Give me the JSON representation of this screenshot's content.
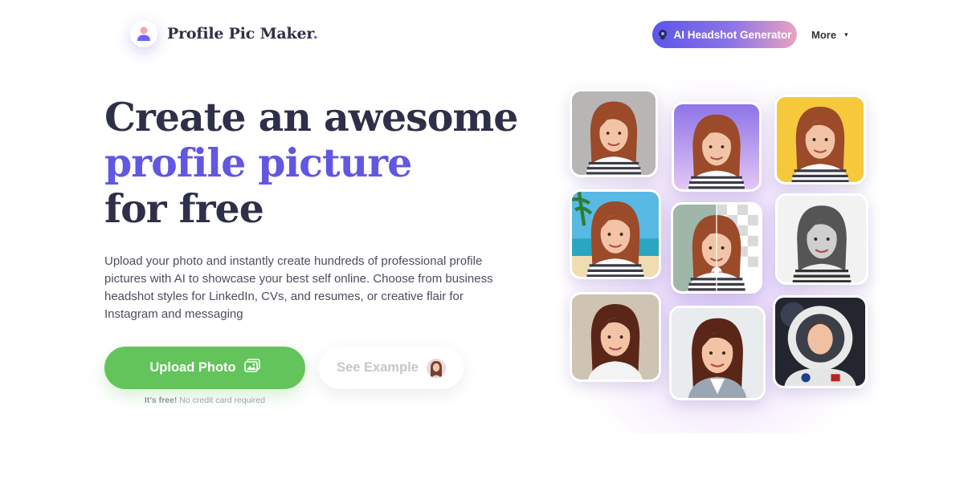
{
  "brand": {
    "name": "Profile Pic Maker",
    "dot": "."
  },
  "nav": {
    "ai_button_label": "AI Headshot Generator",
    "more_label": "More",
    "more_caret": "▾"
  },
  "hero": {
    "line1": "Create an awesome",
    "line2": "profile picture",
    "line3": "for free",
    "description": "Upload your photo and instantly create hundreds of professional profile pictures with AI to showcase your best self online. Choose from business headshot styles for LinkedIn, CVs, and resumes, or creative flair for Instagram and messaging",
    "upload_label": "Upload Photo",
    "example_label": "See Example",
    "note_strong": "It's free!",
    "note_rest": "No credit card required"
  },
  "gallery": [
    {
      "background": "gray",
      "style": "original"
    },
    {
      "background": "purple",
      "style": "cutout"
    },
    {
      "background": "yellow",
      "style": "color"
    },
    {
      "background": "beach",
      "style": "scene"
    },
    {
      "background": "transparent",
      "style": "remove-background"
    },
    {
      "background": "white",
      "style": "black-and-white"
    },
    {
      "background": "beige",
      "style": "portrait"
    },
    {
      "background": "light",
      "style": "business-headshot"
    },
    {
      "background": "space",
      "style": "astronaut"
    }
  ],
  "colors": {
    "accent": "#6157e0",
    "upload_green": "#62c45a",
    "heading": "#2e3049"
  }
}
